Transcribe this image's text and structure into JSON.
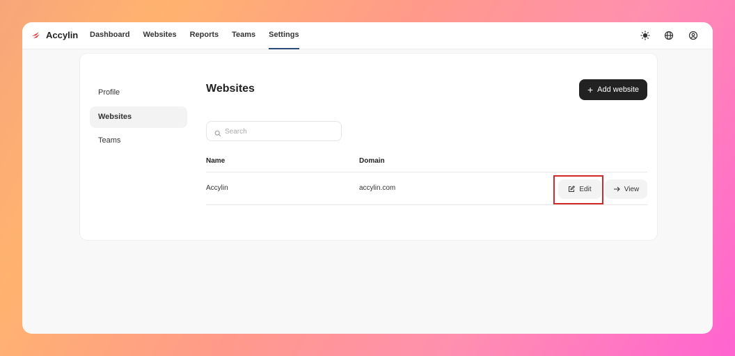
{
  "app": {
    "brand": "Accylin"
  },
  "nav": {
    "items": [
      {
        "label": "Dashboard"
      },
      {
        "label": "Websites"
      },
      {
        "label": "Reports"
      },
      {
        "label": "Teams"
      },
      {
        "label": "Settings"
      }
    ],
    "active": "Settings"
  },
  "toolbar": {
    "icons": [
      "sun-icon",
      "globe-icon",
      "user-icon"
    ]
  },
  "sidebar": {
    "items": [
      {
        "label": "Profile"
      },
      {
        "label": "Websites"
      },
      {
        "label": "Teams"
      }
    ],
    "active": "Websites"
  },
  "main": {
    "title": "Websites",
    "add_button": "Add website",
    "search_placeholder": "Search",
    "table": {
      "headers": [
        "Name",
        "Domain"
      ],
      "rows": [
        {
          "name": "Accylin",
          "domain": "accylin.com",
          "edit_label": "Edit",
          "view_label": "View"
        }
      ]
    }
  },
  "colors": {
    "accent": "#2c4a7c",
    "highlight": "#d42828",
    "button_dark": "#222222"
  }
}
